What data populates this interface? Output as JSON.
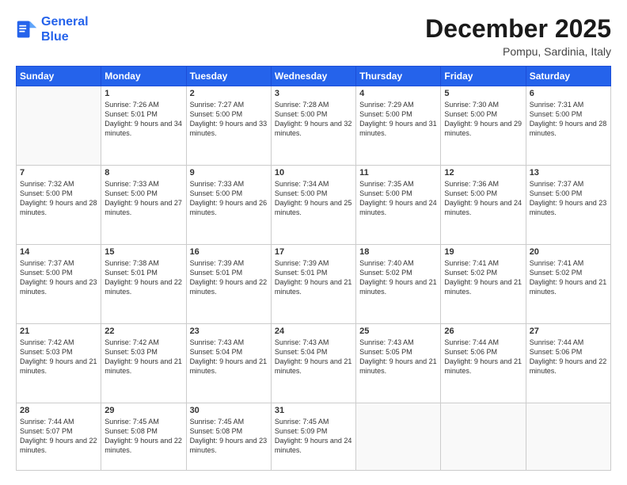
{
  "header": {
    "logo_line1": "General",
    "logo_line2": "Blue",
    "month": "December 2025",
    "location": "Pompu, Sardinia, Italy"
  },
  "weekdays": [
    "Sunday",
    "Monday",
    "Tuesday",
    "Wednesday",
    "Thursday",
    "Friday",
    "Saturday"
  ],
  "weeks": [
    [
      {
        "day": "",
        "sunrise": "",
        "sunset": "",
        "daylight": ""
      },
      {
        "day": "1",
        "sunrise": "Sunrise: 7:26 AM",
        "sunset": "Sunset: 5:01 PM",
        "daylight": "Daylight: 9 hours and 34 minutes."
      },
      {
        "day": "2",
        "sunrise": "Sunrise: 7:27 AM",
        "sunset": "Sunset: 5:00 PM",
        "daylight": "Daylight: 9 hours and 33 minutes."
      },
      {
        "day": "3",
        "sunrise": "Sunrise: 7:28 AM",
        "sunset": "Sunset: 5:00 PM",
        "daylight": "Daylight: 9 hours and 32 minutes."
      },
      {
        "day": "4",
        "sunrise": "Sunrise: 7:29 AM",
        "sunset": "Sunset: 5:00 PM",
        "daylight": "Daylight: 9 hours and 31 minutes."
      },
      {
        "day": "5",
        "sunrise": "Sunrise: 7:30 AM",
        "sunset": "Sunset: 5:00 PM",
        "daylight": "Daylight: 9 hours and 29 minutes."
      },
      {
        "day": "6",
        "sunrise": "Sunrise: 7:31 AM",
        "sunset": "Sunset: 5:00 PM",
        "daylight": "Daylight: 9 hours and 28 minutes."
      }
    ],
    [
      {
        "day": "7",
        "sunrise": "Sunrise: 7:32 AM",
        "sunset": "Sunset: 5:00 PM",
        "daylight": "Daylight: 9 hours and 28 minutes."
      },
      {
        "day": "8",
        "sunrise": "Sunrise: 7:33 AM",
        "sunset": "Sunset: 5:00 PM",
        "daylight": "Daylight: 9 hours and 27 minutes."
      },
      {
        "day": "9",
        "sunrise": "Sunrise: 7:33 AM",
        "sunset": "Sunset: 5:00 PM",
        "daylight": "Daylight: 9 hours and 26 minutes."
      },
      {
        "day": "10",
        "sunrise": "Sunrise: 7:34 AM",
        "sunset": "Sunset: 5:00 PM",
        "daylight": "Daylight: 9 hours and 25 minutes."
      },
      {
        "day": "11",
        "sunrise": "Sunrise: 7:35 AM",
        "sunset": "Sunset: 5:00 PM",
        "daylight": "Daylight: 9 hours and 24 minutes."
      },
      {
        "day": "12",
        "sunrise": "Sunrise: 7:36 AM",
        "sunset": "Sunset: 5:00 PM",
        "daylight": "Daylight: 9 hours and 24 minutes."
      },
      {
        "day": "13",
        "sunrise": "Sunrise: 7:37 AM",
        "sunset": "Sunset: 5:00 PM",
        "daylight": "Daylight: 9 hours and 23 minutes."
      }
    ],
    [
      {
        "day": "14",
        "sunrise": "Sunrise: 7:37 AM",
        "sunset": "Sunset: 5:00 PM",
        "daylight": "Daylight: 9 hours and 23 minutes."
      },
      {
        "day": "15",
        "sunrise": "Sunrise: 7:38 AM",
        "sunset": "Sunset: 5:01 PM",
        "daylight": "Daylight: 9 hours and 22 minutes."
      },
      {
        "day": "16",
        "sunrise": "Sunrise: 7:39 AM",
        "sunset": "Sunset: 5:01 PM",
        "daylight": "Daylight: 9 hours and 22 minutes."
      },
      {
        "day": "17",
        "sunrise": "Sunrise: 7:39 AM",
        "sunset": "Sunset: 5:01 PM",
        "daylight": "Daylight: 9 hours and 21 minutes."
      },
      {
        "day": "18",
        "sunrise": "Sunrise: 7:40 AM",
        "sunset": "Sunset: 5:02 PM",
        "daylight": "Daylight: 9 hours and 21 minutes."
      },
      {
        "day": "19",
        "sunrise": "Sunrise: 7:41 AM",
        "sunset": "Sunset: 5:02 PM",
        "daylight": "Daylight: 9 hours and 21 minutes."
      },
      {
        "day": "20",
        "sunrise": "Sunrise: 7:41 AM",
        "sunset": "Sunset: 5:02 PM",
        "daylight": "Daylight: 9 hours and 21 minutes."
      }
    ],
    [
      {
        "day": "21",
        "sunrise": "Sunrise: 7:42 AM",
        "sunset": "Sunset: 5:03 PM",
        "daylight": "Daylight: 9 hours and 21 minutes."
      },
      {
        "day": "22",
        "sunrise": "Sunrise: 7:42 AM",
        "sunset": "Sunset: 5:03 PM",
        "daylight": "Daylight: 9 hours and 21 minutes."
      },
      {
        "day": "23",
        "sunrise": "Sunrise: 7:43 AM",
        "sunset": "Sunset: 5:04 PM",
        "daylight": "Daylight: 9 hours and 21 minutes."
      },
      {
        "day": "24",
        "sunrise": "Sunrise: 7:43 AM",
        "sunset": "Sunset: 5:04 PM",
        "daylight": "Daylight: 9 hours and 21 minutes."
      },
      {
        "day": "25",
        "sunrise": "Sunrise: 7:43 AM",
        "sunset": "Sunset: 5:05 PM",
        "daylight": "Daylight: 9 hours and 21 minutes."
      },
      {
        "day": "26",
        "sunrise": "Sunrise: 7:44 AM",
        "sunset": "Sunset: 5:06 PM",
        "daylight": "Daylight: 9 hours and 21 minutes."
      },
      {
        "day": "27",
        "sunrise": "Sunrise: 7:44 AM",
        "sunset": "Sunset: 5:06 PM",
        "daylight": "Daylight: 9 hours and 22 minutes."
      }
    ],
    [
      {
        "day": "28",
        "sunrise": "Sunrise: 7:44 AM",
        "sunset": "Sunset: 5:07 PM",
        "daylight": "Daylight: 9 hours and 22 minutes."
      },
      {
        "day": "29",
        "sunrise": "Sunrise: 7:45 AM",
        "sunset": "Sunset: 5:08 PM",
        "daylight": "Daylight: 9 hours and 22 minutes."
      },
      {
        "day": "30",
        "sunrise": "Sunrise: 7:45 AM",
        "sunset": "Sunset: 5:08 PM",
        "daylight": "Daylight: 9 hours and 23 minutes."
      },
      {
        "day": "31",
        "sunrise": "Sunrise: 7:45 AM",
        "sunset": "Sunset: 5:09 PM",
        "daylight": "Daylight: 9 hours and 24 minutes."
      },
      {
        "day": "",
        "sunrise": "",
        "sunset": "",
        "daylight": ""
      },
      {
        "day": "",
        "sunrise": "",
        "sunset": "",
        "daylight": ""
      },
      {
        "day": "",
        "sunrise": "",
        "sunset": "",
        "daylight": ""
      }
    ]
  ]
}
